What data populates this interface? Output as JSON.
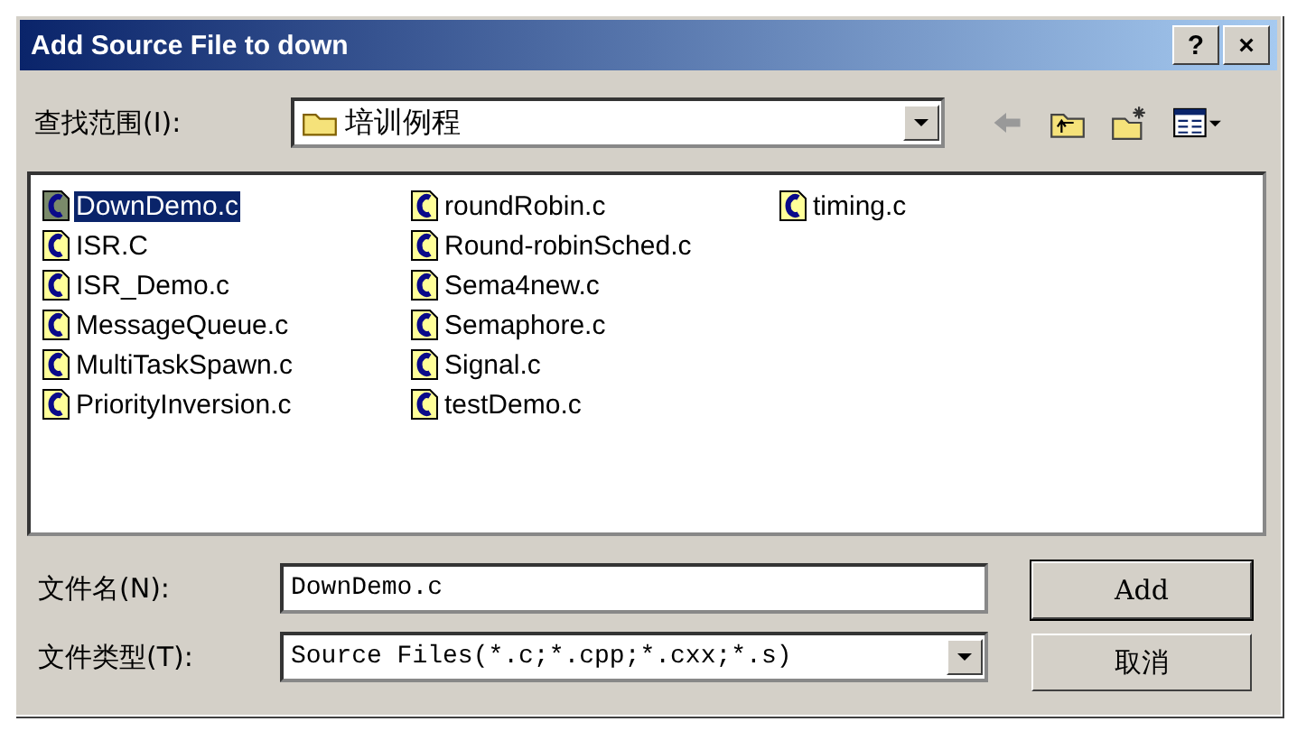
{
  "window": {
    "title": "Add Source File to down",
    "buttons": [
      "?",
      "×"
    ]
  },
  "look_in": {
    "label": "查找范围(I):",
    "value": "培训例程"
  },
  "files": [
    {
      "name": "DownDemo.c",
      "selected": true
    },
    {
      "name": "ISR.C",
      "selected": false
    },
    {
      "name": "ISR_Demo.c",
      "selected": false
    },
    {
      "name": "MessageQueue.c",
      "selected": false
    },
    {
      "name": "MultiTaskSpawn.c",
      "selected": false
    },
    {
      "name": "PriorityInversion.c",
      "selected": false
    },
    {
      "name": "roundRobin.c",
      "selected": false
    },
    {
      "name": "Round-robinSched.c",
      "selected": false
    },
    {
      "name": "Sema4new.c",
      "selected": false
    },
    {
      "name": "Semaphore.c",
      "selected": false
    },
    {
      "name": "Signal.c",
      "selected": false
    },
    {
      "name": "testDemo.c",
      "selected": false
    },
    {
      "name": "timing.c",
      "selected": false
    }
  ],
  "file_name": {
    "label": "文件名(N):",
    "value": "DownDemo.c"
  },
  "file_type": {
    "label": "文件类型(T):",
    "value": "Source Files(*.c;*.cpp;*.cxx;*.s)"
  },
  "buttons": [
    "Add",
    "取消"
  ]
}
